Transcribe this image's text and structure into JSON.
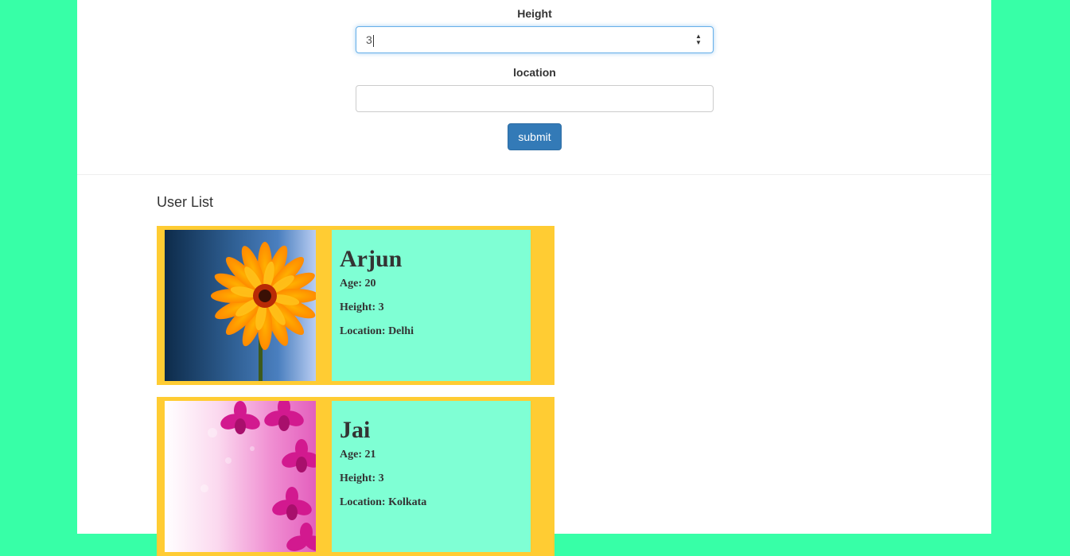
{
  "form": {
    "height": {
      "label": "Height",
      "value": "3"
    },
    "location": {
      "label": "location",
      "value": ""
    },
    "submit_label": "submit"
  },
  "user_list": {
    "title": "User List",
    "users": [
      {
        "name": "Arjun",
        "age_label": "Age:",
        "age": "20",
        "height_label": "Height:",
        "height": "3",
        "location_label": "Location:",
        "location": "Delhi",
        "photo": "orange-gerbera-flower-photo"
      },
      {
        "name": "Jai",
        "age_label": "Age:",
        "age": "21",
        "height_label": "Height:",
        "height": "3",
        "location_label": "Location:",
        "location": "Kolkata",
        "photo": "pink-orchid-flower-photo"
      }
    ]
  },
  "colors": {
    "page_background": "#37ffa7",
    "card_background": "#ffcc33",
    "info_background": "#7fffd4",
    "button": "#337ab7"
  }
}
